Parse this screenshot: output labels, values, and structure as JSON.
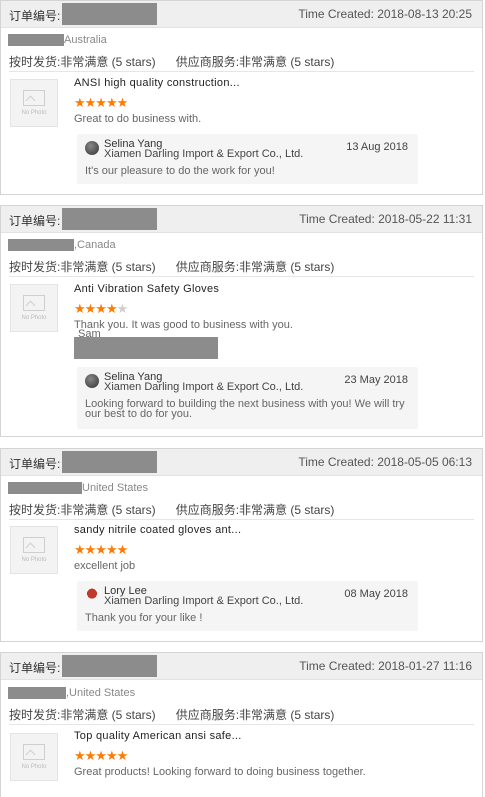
{
  "order_label": "订单编号:",
  "rating_shipping": "按时发货:非常满意 (5 stars)",
  "rating_service": "供应商服务:非常满意 (5 stars)",
  "no_photo": "No Photo",
  "company": "Xiamen Darling Import & Export Co., Ltd.",
  "reviews": [
    {
      "time": "Time Created: 2018-08-13 20:25",
      "buyer": "Australia",
      "product": "ANSI high quality construction...",
      "stars": 5,
      "comment": "Great to do business with.",
      "reply_name": "Selina Yang",
      "reply_date": "13 Aug 2018",
      "reply_text": "It's our pleasure to do the work for you!"
    },
    {
      "time": "Time Created: 2018-05-22 11:31",
      "buyer": ",Canada",
      "product": "Anti Vibration Safety Gloves",
      "stars": 4,
      "comment": "Thank you. It was good to business with you.",
      "comment2": "Sam",
      "reply_name": "Selina Yang",
      "reply_date": "23 May 2018",
      "reply_text": "Looking forward to building the next business with you! We will try our best to do for you."
    },
    {
      "time": "Time Created: 2018-05-05 06:13",
      "buyer": "United States",
      "product": "sandy nitrile coated gloves ant...",
      "stars": 5,
      "comment": "excellent job",
      "reply_name": "Lory Lee",
      "reply_date": "08 May 2018",
      "reply_text": "Thank you for your like !"
    },
    {
      "time": "Time Created: 2018-01-27 11:16",
      "buyer": ",United States",
      "product": "Top quality American ansi safe...",
      "stars": 5,
      "comment": "Great products! Looking forward to doing business together."
    }
  ]
}
